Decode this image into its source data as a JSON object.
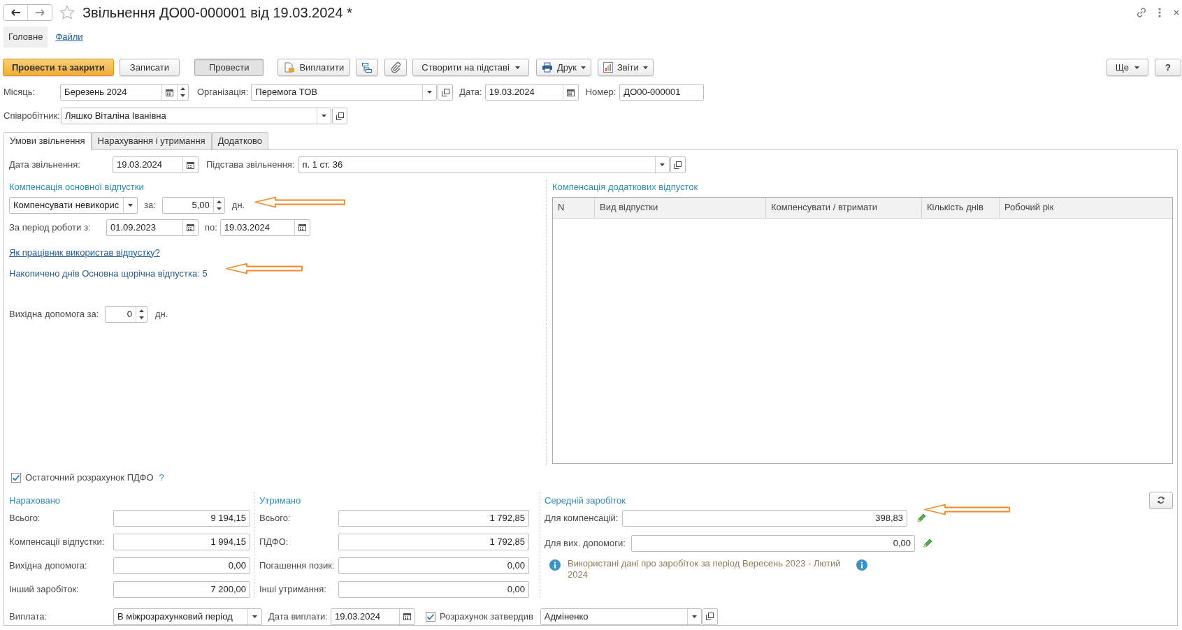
{
  "window": {
    "title": "Звільнення ДО00-000001 від 19.03.2024 *"
  },
  "nav_tabs": [
    {
      "label": "Головне",
      "selected": true
    },
    {
      "label": "Файли",
      "selected": false
    }
  ],
  "toolbar": [
    {
      "kind": "primary",
      "label": "Провести та закрити"
    },
    {
      "kind": "plain",
      "label": "Записати"
    },
    {
      "kind": "default",
      "label": "Провести"
    },
    {
      "kind": "icon_label",
      "label": "Виплатити"
    },
    {
      "kind": "icon_only"
    },
    {
      "kind": "icon_only"
    },
    {
      "kind": "menu",
      "label": "Створити на підставі"
    },
    {
      "kind": "icon_menu",
      "label": "Друк"
    },
    {
      "kind": "icon_menu",
      "label": "Звіти"
    }
  ],
  "toolbar_right": [
    {
      "kind": "menu",
      "label": "Ще"
    },
    {
      "kind": "plain",
      "label": "?"
    }
  ],
  "header": {
    "month": {
      "label": "Місяць:",
      "value": "Березень 2024"
    },
    "organization": {
      "label": "Організація:",
      "value": "Перемога ТОВ"
    },
    "date": {
      "label": "Дата:",
      "value": "19.03.2024"
    },
    "number": {
      "label": "Номер:",
      "value": "ДО00-000001"
    },
    "employee": {
      "label": "Співробітник:",
      "value": "Ляшко Віталіна Іванівна"
    }
  },
  "doc_tabs": [
    {
      "label": "Умови звільнення",
      "selected": true
    },
    {
      "label": "Нарахування і утримання",
      "selected": false
    },
    {
      "label": "Додатково",
      "selected": false
    }
  ],
  "conditions": {
    "dismissal_date": {
      "label": "Дата звільнення:",
      "value": "19.03.2024"
    },
    "dismissal_basis": {
      "label": "Підстава звільнення:",
      "value": "п. 1 ст. 36"
    },
    "main_leave": {
      "title": "Компенсація основної відпустки",
      "mode": "Компенсувати невикорис",
      "days_label": "за:",
      "days": "5,00",
      "unit": "дн."
    },
    "period": {
      "label": "За період роботи з:",
      "from": "01.09.2023",
      "to_label": "по:",
      "to": "19.03.2024"
    },
    "usage_link": "Як працівник використав відпустку?",
    "accrued_days": "Накопичено днів Основна щорічна відпустка: 5",
    "severance": {
      "label": "Вихідна допомога за:",
      "value": "0",
      "unit": "дн."
    }
  },
  "additional_leave": {
    "title": "Компенсація додаткових відпусток",
    "columns": [
      "N",
      "Вид відпустки",
      "Компенсувати / втримати",
      "Кількість днів",
      "Робочий рік"
    ]
  },
  "final_pdfo": {
    "label": "Остаточний розрахунок ПДФО",
    "checked": true,
    "help": "?"
  },
  "accrued": {
    "title": "Нараховано",
    "rows": [
      {
        "label": "Всього:",
        "value": "9 194,15"
      },
      {
        "label": "Компенсації відпустки:",
        "value": "1 994,15"
      },
      {
        "label": "Вихідна допомога:",
        "value": "0,00"
      },
      {
        "label": "Інший заробіток:",
        "value": "7 200,00"
      }
    ]
  },
  "withheld": {
    "title": "Утримано",
    "rows": [
      {
        "label": "Всього:",
        "value": "1 792,85"
      },
      {
        "label": "ПДФО:",
        "value": "1 792,85"
      },
      {
        "label": "Погашення позик:",
        "value": "0,00"
      },
      {
        "label": "Інші утримання:",
        "value": "0,00"
      }
    ]
  },
  "average": {
    "title": "Середній заробіток",
    "rows": [
      {
        "label": "Для компенсацій:",
        "value": "398,83"
      },
      {
        "label": "Для вих. допомоги:",
        "value": "0,00"
      }
    ],
    "note": "Використані дані про заробіток за період Вересень 2023 - Лютий 2024"
  },
  "payment": {
    "label": "Виплата:",
    "value": "В міжрозрахунковий період",
    "date_label": "Дата виплати:",
    "date": "19.03.2024",
    "approved_label": "Розрахунок затвердив",
    "approved": true,
    "approver": "Адміненко"
  }
}
